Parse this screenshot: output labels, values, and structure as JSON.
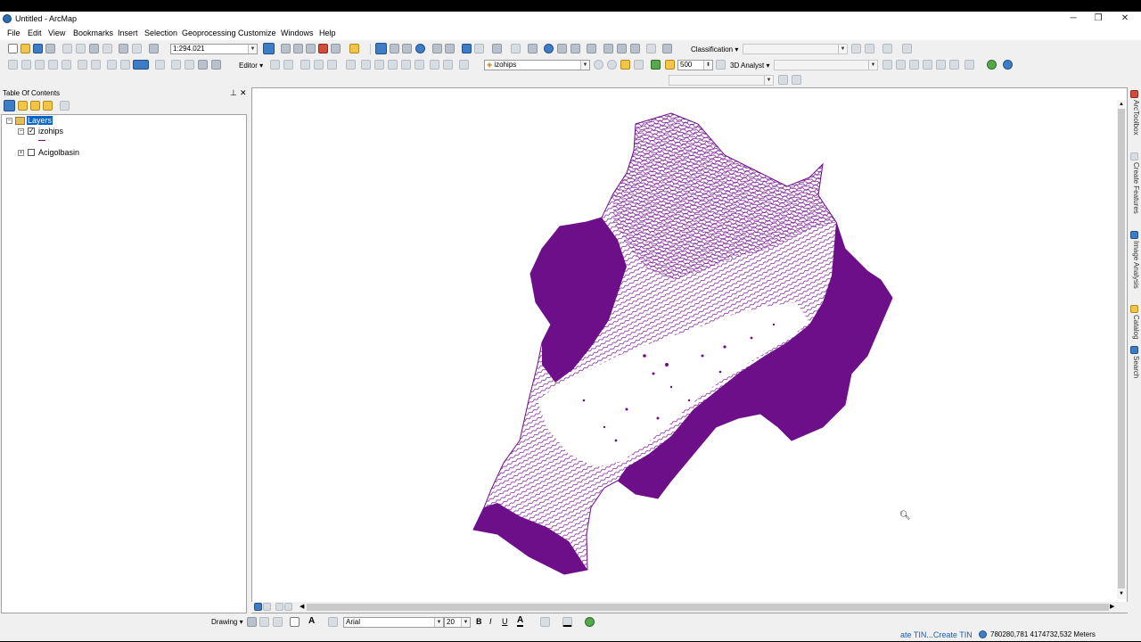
{
  "window": {
    "title": "Untitled - ArcMap",
    "controls": [
      "─",
      "❐",
      "✕"
    ]
  },
  "menu": [
    "File",
    "Edit",
    "View",
    "Bookmarks",
    "Insert",
    "Selection",
    "Geoprocessing",
    "Customize",
    "Windows",
    "Help"
  ],
  "toolbar": {
    "scale": "1:294.021",
    "classification_label": "Classification ▾",
    "editor_label": "Editor ▾",
    "layer_select": "izohips",
    "resolution": "500",
    "analyst_label": "3D Analyst ▾"
  },
  "toc": {
    "title": "Table Of Contents",
    "pin": "⊥",
    "close": "✕",
    "root_label": "Layers",
    "layers": [
      {
        "name": "izohips",
        "checked": true,
        "expanded": true
      },
      {
        "name": "Acigolbasin",
        "checked": false,
        "expanded": false
      }
    ]
  },
  "map": {
    "fill_color": "#6e0f8a",
    "background": "#ffffff"
  },
  "right_dock": [
    "ArcToolbox",
    "Create Features",
    "Image Analysis",
    "Catalog",
    "Search"
  ],
  "drawing": {
    "label": "Drawing ▾",
    "font": "Arial",
    "size": "20",
    "bold": "B",
    "italic": "I",
    "underline": "U"
  },
  "status": {
    "message": "ate TIN...Create TIN",
    "coords": "780280,781  4174732,532 Meters"
  },
  "colors": {
    "accent": "#2a6fb0",
    "status_blue": "#1c5fb5",
    "selection": "#0a64c8"
  }
}
